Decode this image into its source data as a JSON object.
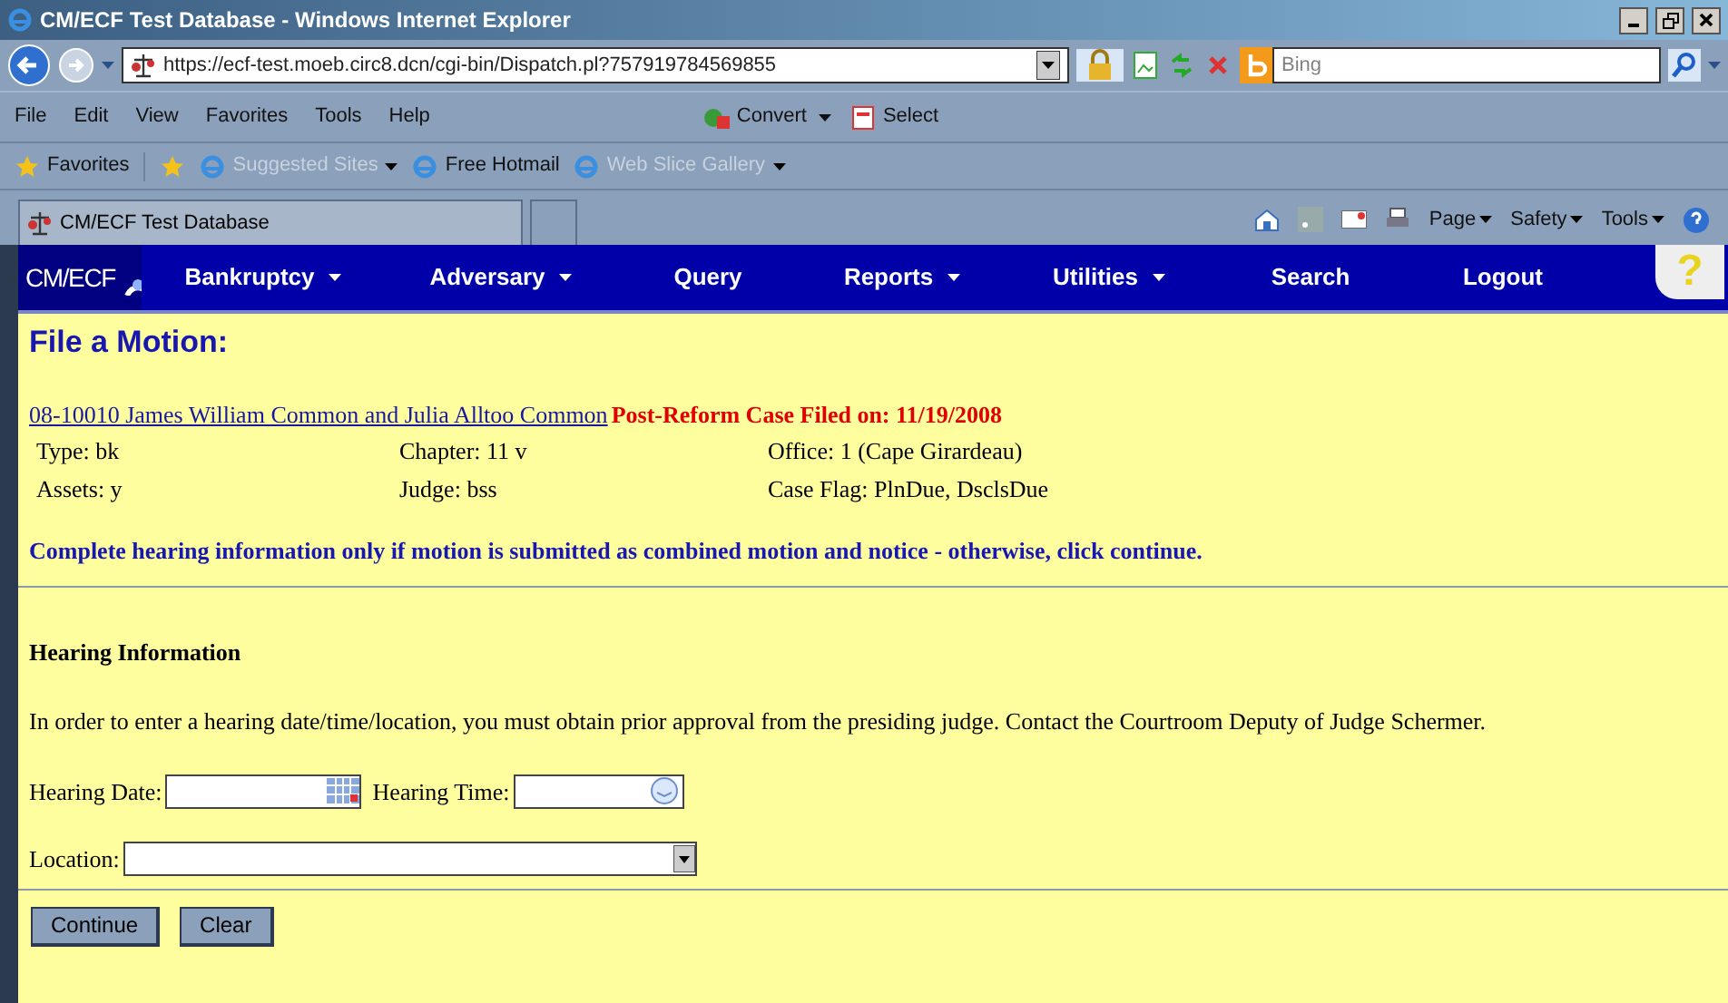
{
  "window": {
    "title": "CM/ECF Test Database - Windows Internet Explorer"
  },
  "address_bar": {
    "url": "https://ecf-test.moeb.circ8.dcn/cgi-bin/Dispatch.pl?757919784569855",
    "search_placeholder": "Bing"
  },
  "menu_bar": [
    "File",
    "Edit",
    "View",
    "Favorites",
    "Tools",
    "Help"
  ],
  "menu_tools": [
    "Convert",
    "Select"
  ],
  "favorites_bar": [
    {
      "label": "Favorites",
      "disabled": false
    },
    {
      "label": "Suggested Sites",
      "disabled": true,
      "dropdown": true
    },
    {
      "label": "Free Hotmail",
      "disabled": false,
      "dropdown": false
    },
    {
      "label": "Web Slice Gallery",
      "disabled": true,
      "dropdown": true
    }
  ],
  "tab": {
    "title": "CM/ECF Test Database"
  },
  "command_bar": [
    "Page",
    "Safety",
    "Tools"
  ],
  "nav": {
    "logo": "CM/ECF",
    "items": [
      {
        "label": "Bankruptcy",
        "dropdown": true
      },
      {
        "label": "Adversary",
        "dropdown": true
      },
      {
        "label": "Query",
        "dropdown": false
      },
      {
        "label": "Reports",
        "dropdown": true
      },
      {
        "label": "Utilities",
        "dropdown": true
      },
      {
        "label": "Search",
        "dropdown": false
      },
      {
        "label": "Logout",
        "dropdown": false
      }
    ],
    "help": "?"
  },
  "page": {
    "heading": "File a Motion:",
    "case_link": "08-10010 James William Common and Julia Alltoo Common",
    "case_status": "Post-Reform Case Filed on: 11/19/2008",
    "case_info": [
      [
        "Type: bk",
        "Chapter: 11 v",
        "Office: 1 (Cape Girardeau)"
      ],
      [
        "Assets: y",
        "Judge: bss",
        "Case Flag: PlnDue, DsclsDue"
      ]
    ],
    "notice": "Complete hearing information only if motion is submitted as combined motion and notice - otherwise, click continue.",
    "section_title": "Hearing Information",
    "instructions": "In order to enter a hearing date/time/location, you must obtain prior approval from the presiding judge. Contact the Courtroom Deputy of Judge Schermer.",
    "hearing_date_label": "Hearing Date:",
    "hearing_time_label": "Hearing Time:",
    "location_label": "Location:",
    "buttons": [
      "Continue",
      "Clear"
    ]
  }
}
